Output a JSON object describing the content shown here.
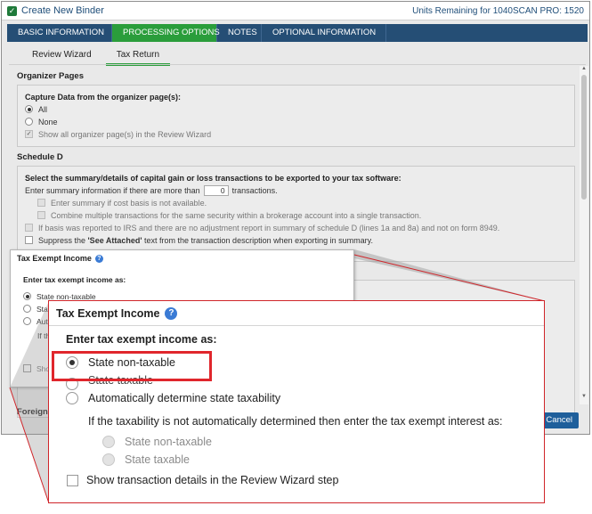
{
  "window": {
    "title": "Create New Binder",
    "units_remaining": "Units Remaining for 1040SCAN PRO: 1520",
    "close_glyph": "×"
  },
  "tabs": [
    {
      "label": "BASIC INFORMATION"
    },
    {
      "label": "PROCESSING OPTIONS"
    },
    {
      "label": "NOTES"
    },
    {
      "label": "OPTIONAL INFORMATION"
    }
  ],
  "subtabs": [
    {
      "label": "Review Wizard"
    },
    {
      "label": "Tax Return"
    }
  ],
  "organizer": {
    "title": "Organizer Pages",
    "heading": "Capture Data from the organizer page(s):",
    "opt_all": "All",
    "opt_none": "None",
    "show_all": "Show all organizer page(s) in the Review Wizard"
  },
  "schedule_d": {
    "title": "Schedule D",
    "heading": "Select the summary/details of capital gain or loss transactions to be exported to your tax software:",
    "enter_summary_prefix": "Enter summary information if there are more than",
    "transactions_count": "0",
    "enter_summary_suffix": "transactions.",
    "opt_cost_basis": "Enter summary if cost basis is not available.",
    "opt_combine": "Combine multiple transactions for the same security within a brokerage account into a single transaction.",
    "opt_basis_irs": "If basis was reported to IRS and there are no adjustment report in summary of schedule D (lines 1a and 8a) and not on form 8949.",
    "opt_suppress_pre": "Suppress the ",
    "opt_suppress_bold": "'See Attached'",
    "opt_suppress_post": " text from the transaction description when exporting in summary."
  },
  "foreign_partial": "Foreign T",
  "cancel_label": "Cancel",
  "cancel_partial": "Cancel",
  "small_popup": {
    "title": "Tax Exempt Income",
    "heading": "Enter tax exempt income as:",
    "opt1": "State non-taxable",
    "opt2_partial": "Sta",
    "opt3_partial": "Aut",
    "if_partial": "If th",
    "show_partial": "Sho"
  },
  "zoom": {
    "title": "Tax Exempt Income",
    "help": "?",
    "heading": "Enter tax exempt income as:",
    "opt_non_taxable": "State non-taxable",
    "opt_taxable_cut": "State taxable",
    "opt_auto": "Automatically determine state taxability",
    "if_not_auto": "If the taxability is not automatically determined then enter the tax exempt interest as:",
    "sub_non_taxable": "State non-taxable",
    "sub_taxable": "State taxable",
    "show_details": "Show transaction details in the Review Wizard step"
  },
  "colors": {
    "nav_blue": "#254e75",
    "active_green": "#2a9d3b",
    "callout_red": "#d0252a",
    "button_blue": "#1f5f9b"
  }
}
